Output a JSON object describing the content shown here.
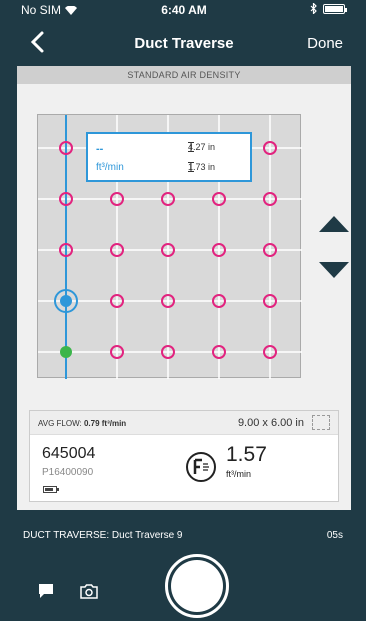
{
  "status": {
    "carrier": "No SIM",
    "time": "6:40 AM"
  },
  "nav": {
    "title": "Duct Traverse",
    "done_label": "Done"
  },
  "density_label": "STANDARD AIR DENSITY",
  "info": {
    "value": "--",
    "unit": "ft³/min",
    "dim1": "4.27 in",
    "dim2": "1.73 in"
  },
  "flow": {
    "avg_label": "AVG FLOW:",
    "avg_value": "0.79 ft³/min",
    "size": "9.00 x 6.00 in",
    "serial": "645004",
    "model": "P16400090",
    "value": "1.57",
    "unit": "ft³/min"
  },
  "bottom": {
    "traverse_label": "DUCT TRAVERSE: Duct Traverse 9",
    "elapsed": "05s"
  },
  "colors": {
    "accent": "#2e97d9",
    "point": "#e2237f",
    "done_point": "#3bb54a",
    "bar": "#1f3a45"
  }
}
